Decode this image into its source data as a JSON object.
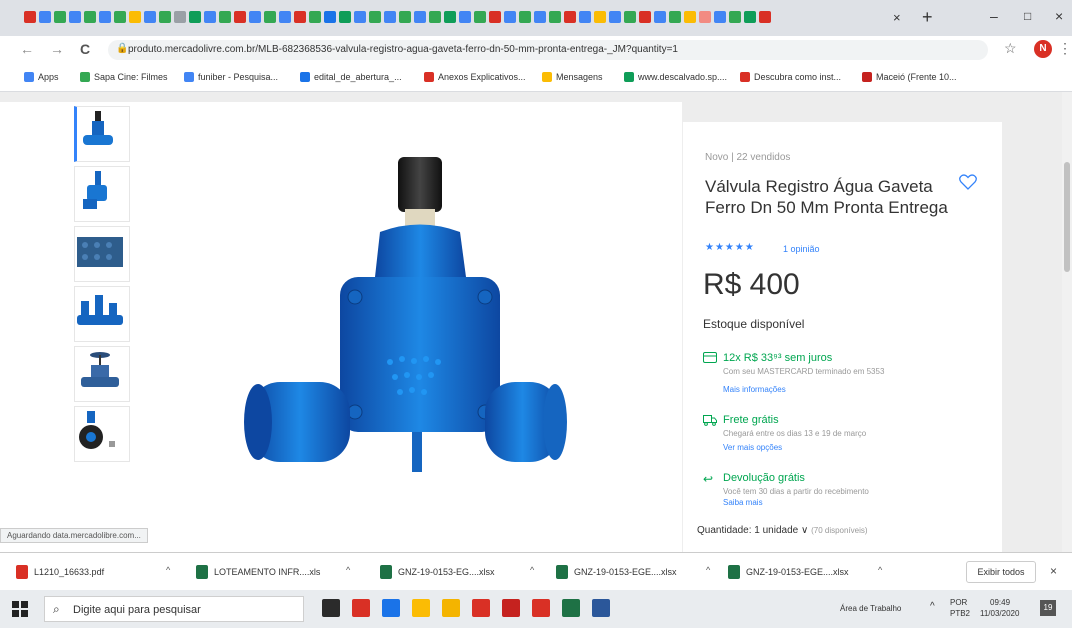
{
  "browser": {
    "tab_close": "×",
    "new_tab": "+",
    "window_controls": {
      "minimize": "–",
      "maximize": "□",
      "close": "×"
    },
    "tab_favicon_colors": [
      "#d93025",
      "#4285f4",
      "#34a853",
      "#4285f4",
      "#34a853",
      "#4285f4",
      "#34a853",
      "#fbbc04",
      "#4285f4",
      "#34a853",
      "#9aa0a6",
      "#0f9d58",
      "#4285f4",
      "#34a853",
      "#d93025",
      "#4285f4",
      "#34a853",
      "#4285f4",
      "#d93025",
      "#34a853",
      "#1a73e8",
      "#0f9d58",
      "#4285f4",
      "#34a853",
      "#4285f4",
      "#34a853",
      "#4285f4",
      "#34a853",
      "#0f9d58",
      "#4285f4",
      "#34a853",
      "#d93025",
      "#4285f4",
      "#34a853",
      "#4285f4",
      "#34a853",
      "#d93025",
      "#4285f4",
      "#fbbc04",
      "#4285f4",
      "#34a853",
      "#d93025",
      "#4285f4",
      "#34a853",
      "#fbbc04",
      "#f28b82",
      "#4285f4",
      "#34a853",
      "#0f9d58",
      "#d93025"
    ],
    "nav": {
      "back": "←",
      "forward": "→",
      "reload": "C"
    },
    "url": "produto.mercadolivre.com.br/MLB-682368536-valvula-registro-agua-gaveta-ferro-dn-50-mm-pronta-entrega-_JM?quantity=1",
    "profile_initial": "N",
    "bookmarks": [
      {
        "label": "Apps",
        "color": "#4285f4"
      },
      {
        "label": "Sapa Cine: Filmes",
        "color": "#34a853"
      },
      {
        "label": "funiber - Pesquisa...",
        "color": "#4285f4"
      },
      {
        "label": "edital_de_abertura_...",
        "color": "#1a73e8"
      },
      {
        "label": "Anexos Explicativos...",
        "color": "#d93025"
      },
      {
        "label": "Mensagens",
        "color": "#fbbc04"
      },
      {
        "label": "www.descalvado.sp....",
        "color": "#0f9d58"
      },
      {
        "label": "Descubra como inst...",
        "color": "#d93025"
      },
      {
        "label": "Maceió (Frente 10...",
        "color": "#c5221f"
      }
    ],
    "status_text": "Aguardando data.mercadolibre.com..."
  },
  "product": {
    "condition": "Novo  |  22 vendidos",
    "title": "Válvula Registro Água Gaveta Ferro Dn 50 Mm Pronta Entrega",
    "stars": "★★★★★",
    "rating_count": "1 opinião",
    "price": "R$ 400",
    "stock": "Estoque disponível",
    "installments": {
      "title": "12x R$ 33⁹³ sem juros",
      "sub": "Com seu MASTERCARD terminado em 5353",
      "link": "Mais informações"
    },
    "shipping": {
      "title": "Frete grátis",
      "sub": "Chegará entre os dias 13 e 19 de março",
      "link": "Ver mais opções"
    },
    "returns": {
      "title": "Devolução grátis",
      "sub": "Você tem 30 dias a partir do recebimento",
      "link": "Saiba mais"
    },
    "quantity_label": "Quantidade: 1 unidade ∨",
    "quantity_available": "(70 disponíveis)"
  },
  "downloads": {
    "items": [
      {
        "name": "L1210_16633.pdf",
        "color": "#d93025"
      },
      {
        "name": "LOTEAMENTO INFR....xls",
        "color": "#1e7145"
      },
      {
        "name": "GNZ-19-0153-EG....xlsx",
        "color": "#1e7145"
      },
      {
        "name": "GNZ-19-0153-EGE....xlsx",
        "color": "#1e7145"
      },
      {
        "name": "GNZ-19-0153-EGE....xlsx",
        "color": "#1e7145"
      }
    ],
    "show_all": "Exibir todos",
    "close": "×"
  },
  "taskbar": {
    "search_placeholder": "Digite aqui para pesquisar",
    "app_colors": [
      "#2b2b2b",
      "#d93025",
      "#1a73e8",
      "#fbbc04",
      "#f4b400",
      "#d93025",
      "#c5221f",
      "#d93025",
      "#1e7145",
      "#2b579a"
    ],
    "desktop_label": "Área de Trabalho",
    "lang1": "POR",
    "lang2": "PTB2",
    "time": "09:49",
    "date": "11/03/2020",
    "notifications": "19"
  }
}
